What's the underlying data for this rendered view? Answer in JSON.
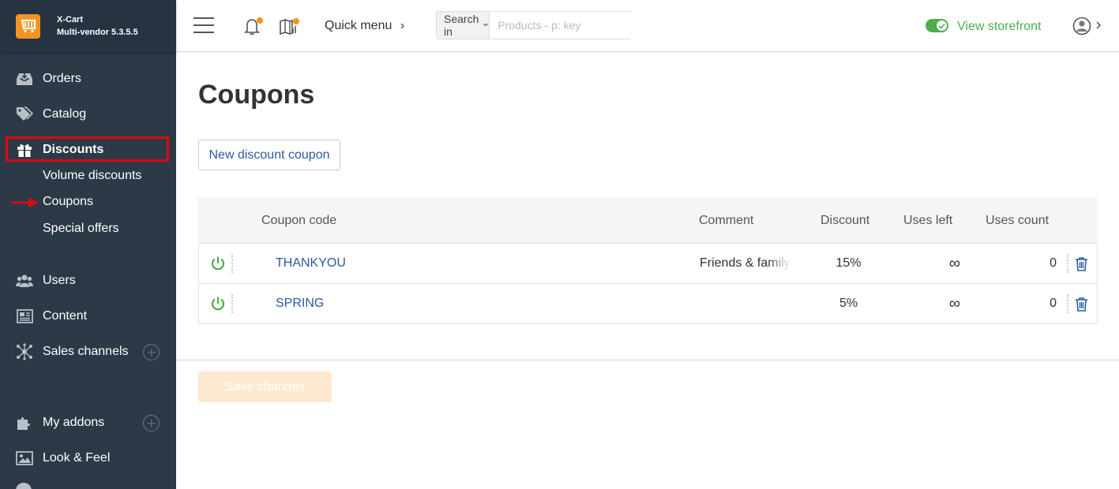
{
  "brand": {
    "name": "X-Cart",
    "version": "Multi-vendor 5.3.5.5"
  },
  "sidebar": {
    "items": [
      {
        "label": "Orders",
        "icon": "inbox-icon"
      },
      {
        "label": "Catalog",
        "icon": "tags-icon"
      },
      {
        "label": "Discounts",
        "icon": "gift-icon",
        "active": true
      },
      {
        "label": "Users",
        "icon": "users-icon"
      },
      {
        "label": "Content",
        "icon": "newspaper-icon"
      },
      {
        "label": "Sales channels",
        "icon": "network-icon",
        "expandable": true
      },
      {
        "label": "My addons",
        "icon": "puzzle-icon",
        "expandable": true
      },
      {
        "label": "Look & Feel",
        "icon": "image-icon"
      }
    ],
    "discount_subitems": [
      "Volume discounts",
      "Coupons",
      "Special offers"
    ],
    "highlight_color": "#e30613"
  },
  "header": {
    "quick_menu": "Quick menu",
    "search_in": "Search in",
    "search_placeholder": "Products - p: key",
    "view_storefront": "View storefront"
  },
  "main": {
    "title": "Coupons",
    "new_button": "New discount coupon",
    "columns": [
      "Coupon code",
      "Comment",
      "Discount",
      "Uses left",
      "Uses count"
    ],
    "rows": [
      {
        "code": "THANKYOU",
        "comment": "Friends & family",
        "discount": "15%",
        "uses_left": "∞",
        "uses_count": "0"
      },
      {
        "code": "SPRING",
        "comment": "",
        "discount": "5%",
        "uses_left": "∞",
        "uses_count": "0"
      }
    ],
    "save_button": "Save changes"
  },
  "colors": {
    "accent": "#f39422",
    "green": "#4cae4c",
    "link": "#2b5a9e",
    "sidebar": "#2c3a47"
  }
}
